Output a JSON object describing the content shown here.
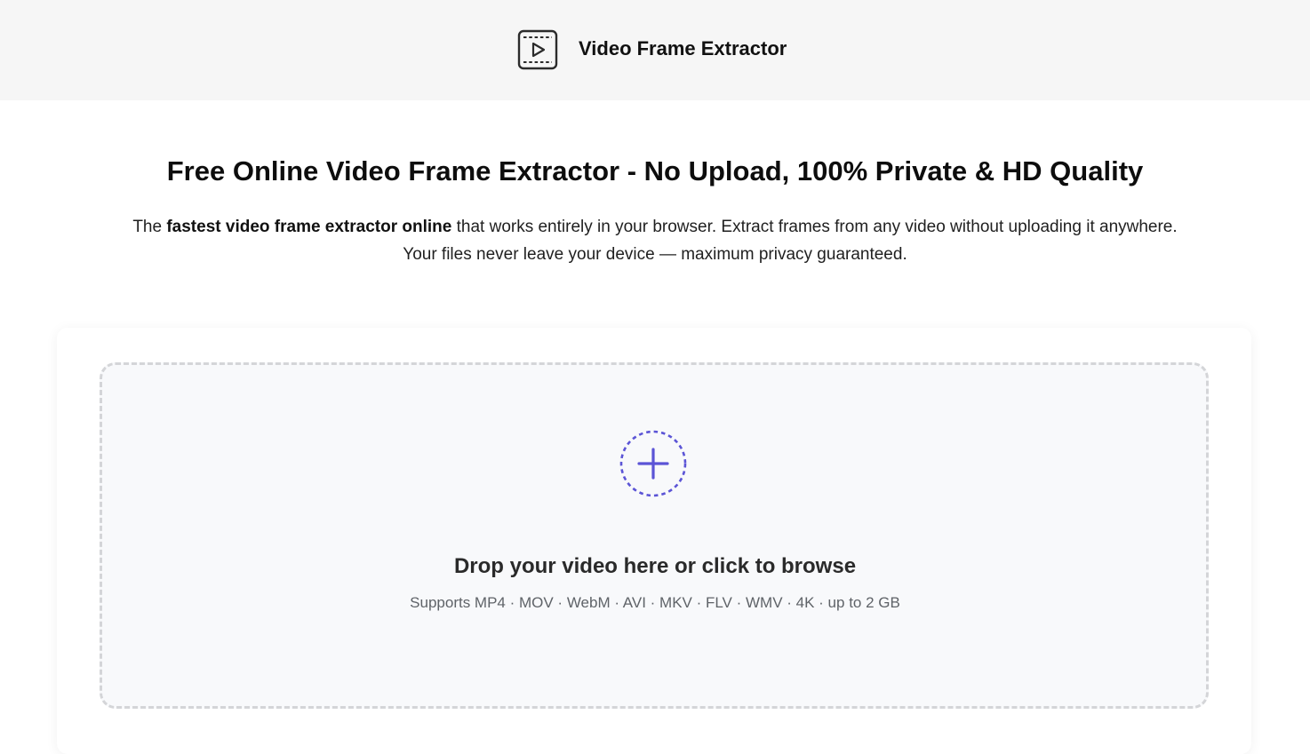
{
  "header": {
    "title": "Video Frame Extractor",
    "logo_icon": "video-frame-icon"
  },
  "hero": {
    "title": "Free Online Video Frame Extractor - No Upload, 100% Private & HD Quality",
    "intro_prefix": "The ",
    "intro_bold": "fastest video frame extractor online",
    "intro_suffix": " that works entirely in your browser. Extract frames from any video without uploading it anywhere.",
    "intro_line2": "Your files never leave your device — maximum privacy guaranteed."
  },
  "dropzone": {
    "icon": "plus-circle-icon",
    "title": "Drop your video here or click to browse",
    "subtitle": "Supports MP4 · MOV · WebM · AVI · MKV · FLV · WMV · 4K · up to 2 GB"
  },
  "colors": {
    "accent": "#5b54d6",
    "header_bg": "#f6f6f6",
    "dropzone_bg": "#f8f9fb",
    "dropzone_border": "#d4d5d8"
  }
}
